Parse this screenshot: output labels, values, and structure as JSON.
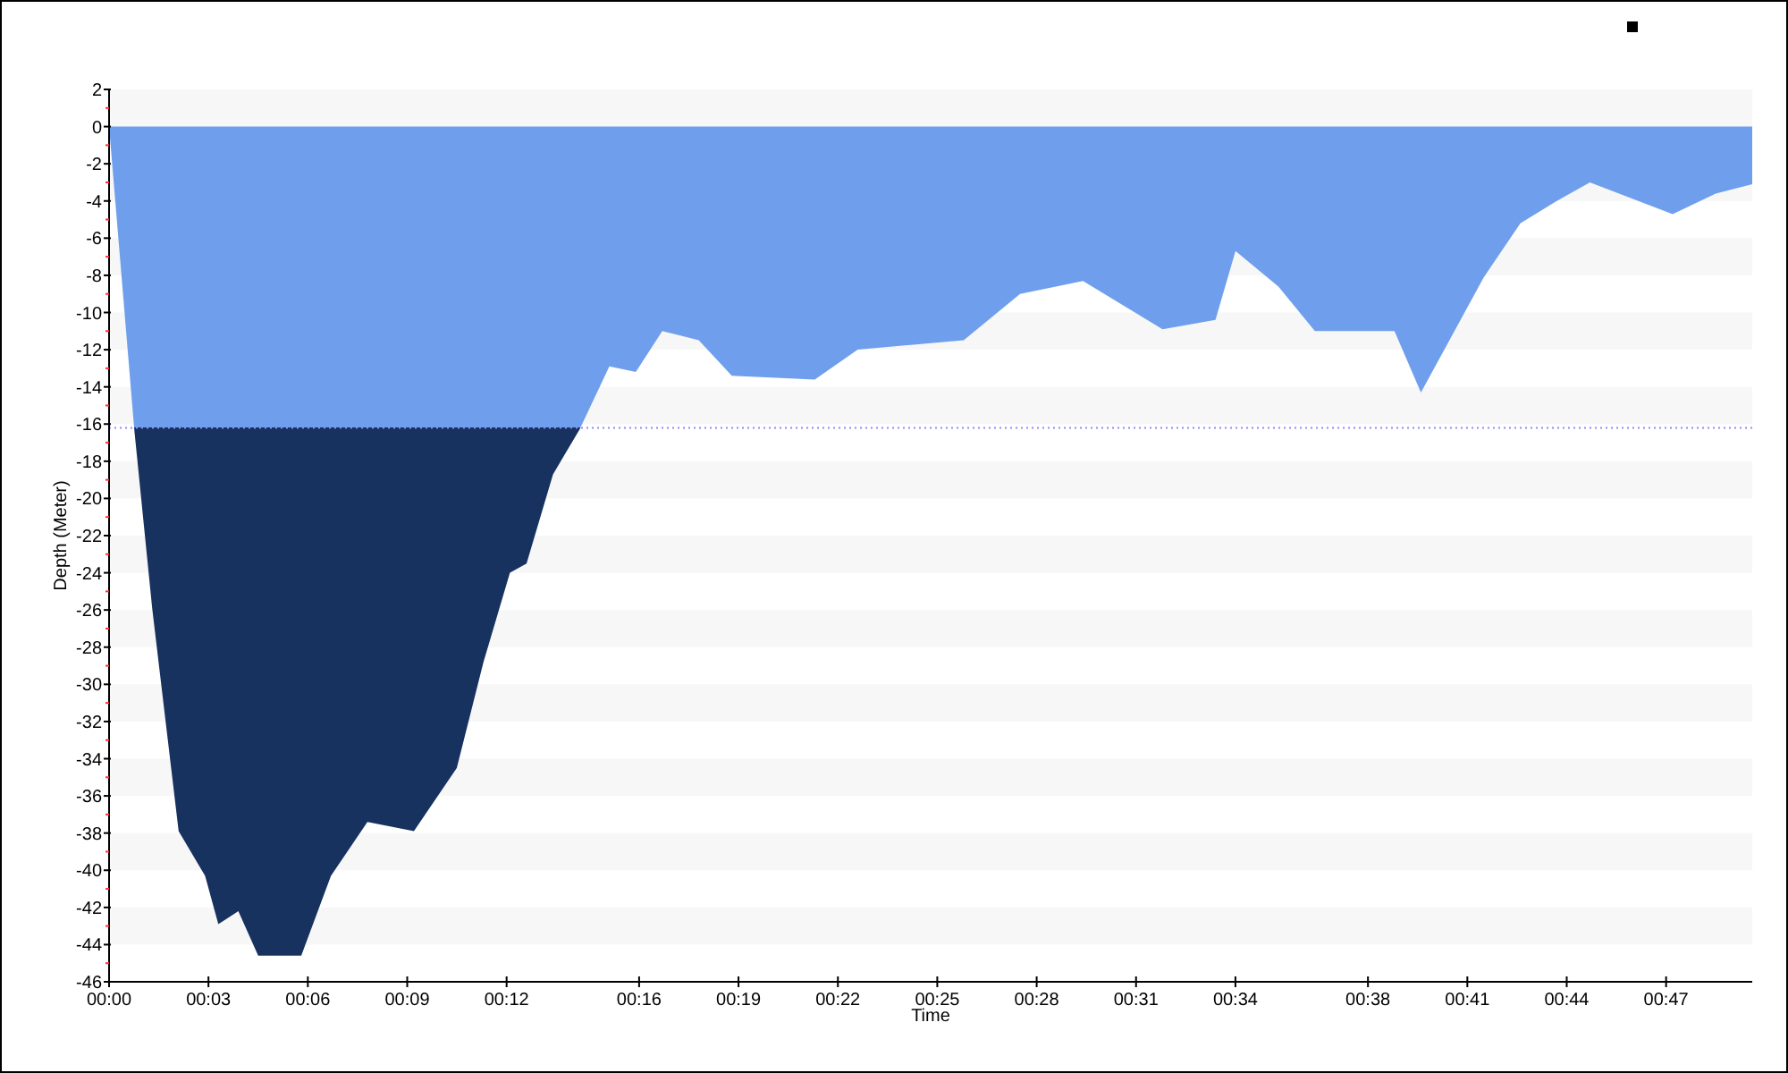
{
  "chart": {
    "chart_data": {
      "type": "area",
      "xlabel": "Time",
      "ylabel": "Depth (Meter)",
      "xlim": [
        0,
        49.6
      ],
      "ylim": [
        -46,
        2
      ],
      "xticks": [
        {
          "value": 0,
          "label": "00:00"
        },
        {
          "value": 3,
          "label": "00:03"
        },
        {
          "value": 6,
          "label": "00:06"
        },
        {
          "value": 9,
          "label": "00:09"
        },
        {
          "value": 12,
          "label": "00:12"
        },
        {
          "value": 16,
          "label": "00:16"
        },
        {
          "value": 19,
          "label": "00:19"
        },
        {
          "value": 22,
          "label": "00:22"
        },
        {
          "value": 25,
          "label": "00:25"
        },
        {
          "value": 28,
          "label": "00:28"
        },
        {
          "value": 31,
          "label": "00:31"
        },
        {
          "value": 34,
          "label": "00:34"
        },
        {
          "value": 38,
          "label": "00:38"
        },
        {
          "value": 41,
          "label": "00:41"
        },
        {
          "value": 44,
          "label": "00:44"
        },
        {
          "value": 47,
          "label": "00:47"
        }
      ],
      "yticks": [
        2,
        0,
        -2,
        -4,
        -6,
        -8,
        -10,
        -12,
        -14,
        -16,
        -18,
        -20,
        -22,
        -24,
        -26,
        -28,
        -30,
        -32,
        -34,
        -36,
        -38,
        -40,
        -42,
        -44,
        -46
      ],
      "x": [
        0,
        0.76,
        1.3,
        2.1,
        2.9,
        3.3,
        3.9,
        4.5,
        5.8,
        6.7,
        7.8,
        9.2,
        10.5,
        11.3,
        12.1,
        12.6,
        13.4,
        14.2,
        15.1,
        15.9,
        16.7,
        17.8,
        18.8,
        21.3,
        22.6,
        25.8,
        27.5,
        29.4,
        31.8,
        33.4,
        34,
        35.3,
        36.4,
        38.8,
        39.6,
        41.5,
        42.6,
        43.7,
        44.7,
        47.2,
        48.5,
        49.6
      ],
      "series": [
        {
          "color": "#6f9fec",
          "values": [
            0,
            -16.3,
            -25.9,
            -37.9,
            -40.3,
            -42.9,
            -42.2,
            -44.6,
            -44.6,
            -40.3,
            -37.4,
            -37.9,
            -34.5,
            -28.8,
            -24,
            -23.5,
            -18.7,
            -16.3,
            -12.9,
            -13.2,
            -11,
            -11.5,
            -13.4,
            -13.6,
            -12,
            -11.5,
            -9,
            -8.3,
            -10.9,
            -10.4,
            -6.7,
            -8.6,
            -11,
            -11,
            -14.3,
            -8.1,
            -5.2,
            -4,
            -3,
            -4.7,
            -3.6,
            -3.1
          ]
        }
      ],
      "ref_lines": [
        {
          "axis": "y",
          "value": -16.2,
          "color": "#8a8aff"
        }
      ]
    }
  }
}
